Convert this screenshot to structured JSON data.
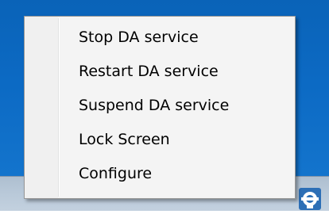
{
  "context_menu": {
    "items": [
      {
        "label": "Stop DA service"
      },
      {
        "label": "Restart DA service"
      },
      {
        "label": "Suspend DA service"
      },
      {
        "label": "Lock Screen"
      },
      {
        "label": "Configure"
      }
    ]
  },
  "tray": {
    "icon": "da-client-icon"
  },
  "colors": {
    "desktop": "#0c6ac4",
    "taskbar": "#b9c9d9",
    "menu_background": "#f4f4f4",
    "menu_border": "#979797"
  }
}
